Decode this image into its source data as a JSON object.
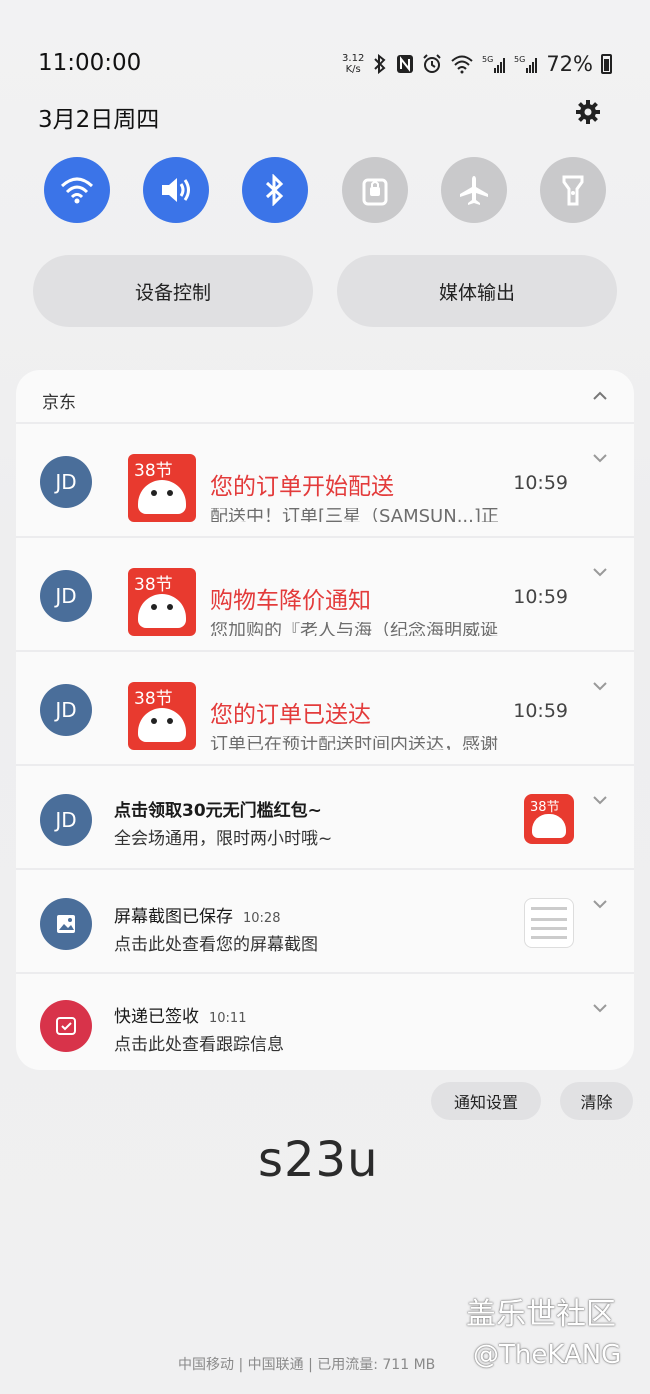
{
  "status": {
    "time": "11:00:00",
    "speed_value": "3.12",
    "speed_unit": "K/s",
    "battery": "72%",
    "date": "3月2日周四"
  },
  "quick_settings": [
    {
      "name": "wifi",
      "on": true
    },
    {
      "name": "sound",
      "on": true
    },
    {
      "name": "bluetooth",
      "on": true
    },
    {
      "name": "rotation-lock",
      "on": false
    },
    {
      "name": "airplane",
      "on": false
    },
    {
      "name": "flashlight",
      "on": false
    }
  ],
  "pills": {
    "device_control": "设备控制",
    "media_output": "媒体输出"
  },
  "group": {
    "title": "京东"
  },
  "jd_notifications": [
    {
      "avatar": "JD",
      "thumb": "38节",
      "title": "您的订单开始配送",
      "time": "10:59",
      "body": "配送中！订单[三星（SAMSUN...]正"
    },
    {
      "avatar": "JD",
      "thumb": "38节",
      "title": "购物车降价通知",
      "time": "10:59",
      "body": "您加购的『老人与海（纪念海明威诞"
    },
    {
      "avatar": "JD",
      "thumb": "38节",
      "title": "您的订单已送达",
      "time": "10:59",
      "body": "订单已在预计配送时间内送达，感谢"
    }
  ],
  "promo": {
    "avatar": "JD",
    "title": "点击领取30元无门槛红包~",
    "body": "全会场通用，限时两小时哦~",
    "thumb": "38节"
  },
  "screenshot": {
    "title": "屏幕截图已保存",
    "time": "10:28",
    "body": "点击此处查看您的屏幕截图"
  },
  "delivery": {
    "title": "快递已签收",
    "time": "10:11",
    "body": "点击此处查看跟踪信息"
  },
  "actions": {
    "settings": "通知设置",
    "clear": "清除"
  },
  "wallpaper_text": "s23u",
  "footer": "中国移动 | 中国联通 | 已用流量: 711 MB",
  "watermark": {
    "site": "盖乐世社区",
    "handle": "@TheKANG"
  },
  "colors": {
    "accent": "#3b74e8",
    "jd_red": "#e83a2f",
    "jd_avatar": "#4a6e9a"
  }
}
